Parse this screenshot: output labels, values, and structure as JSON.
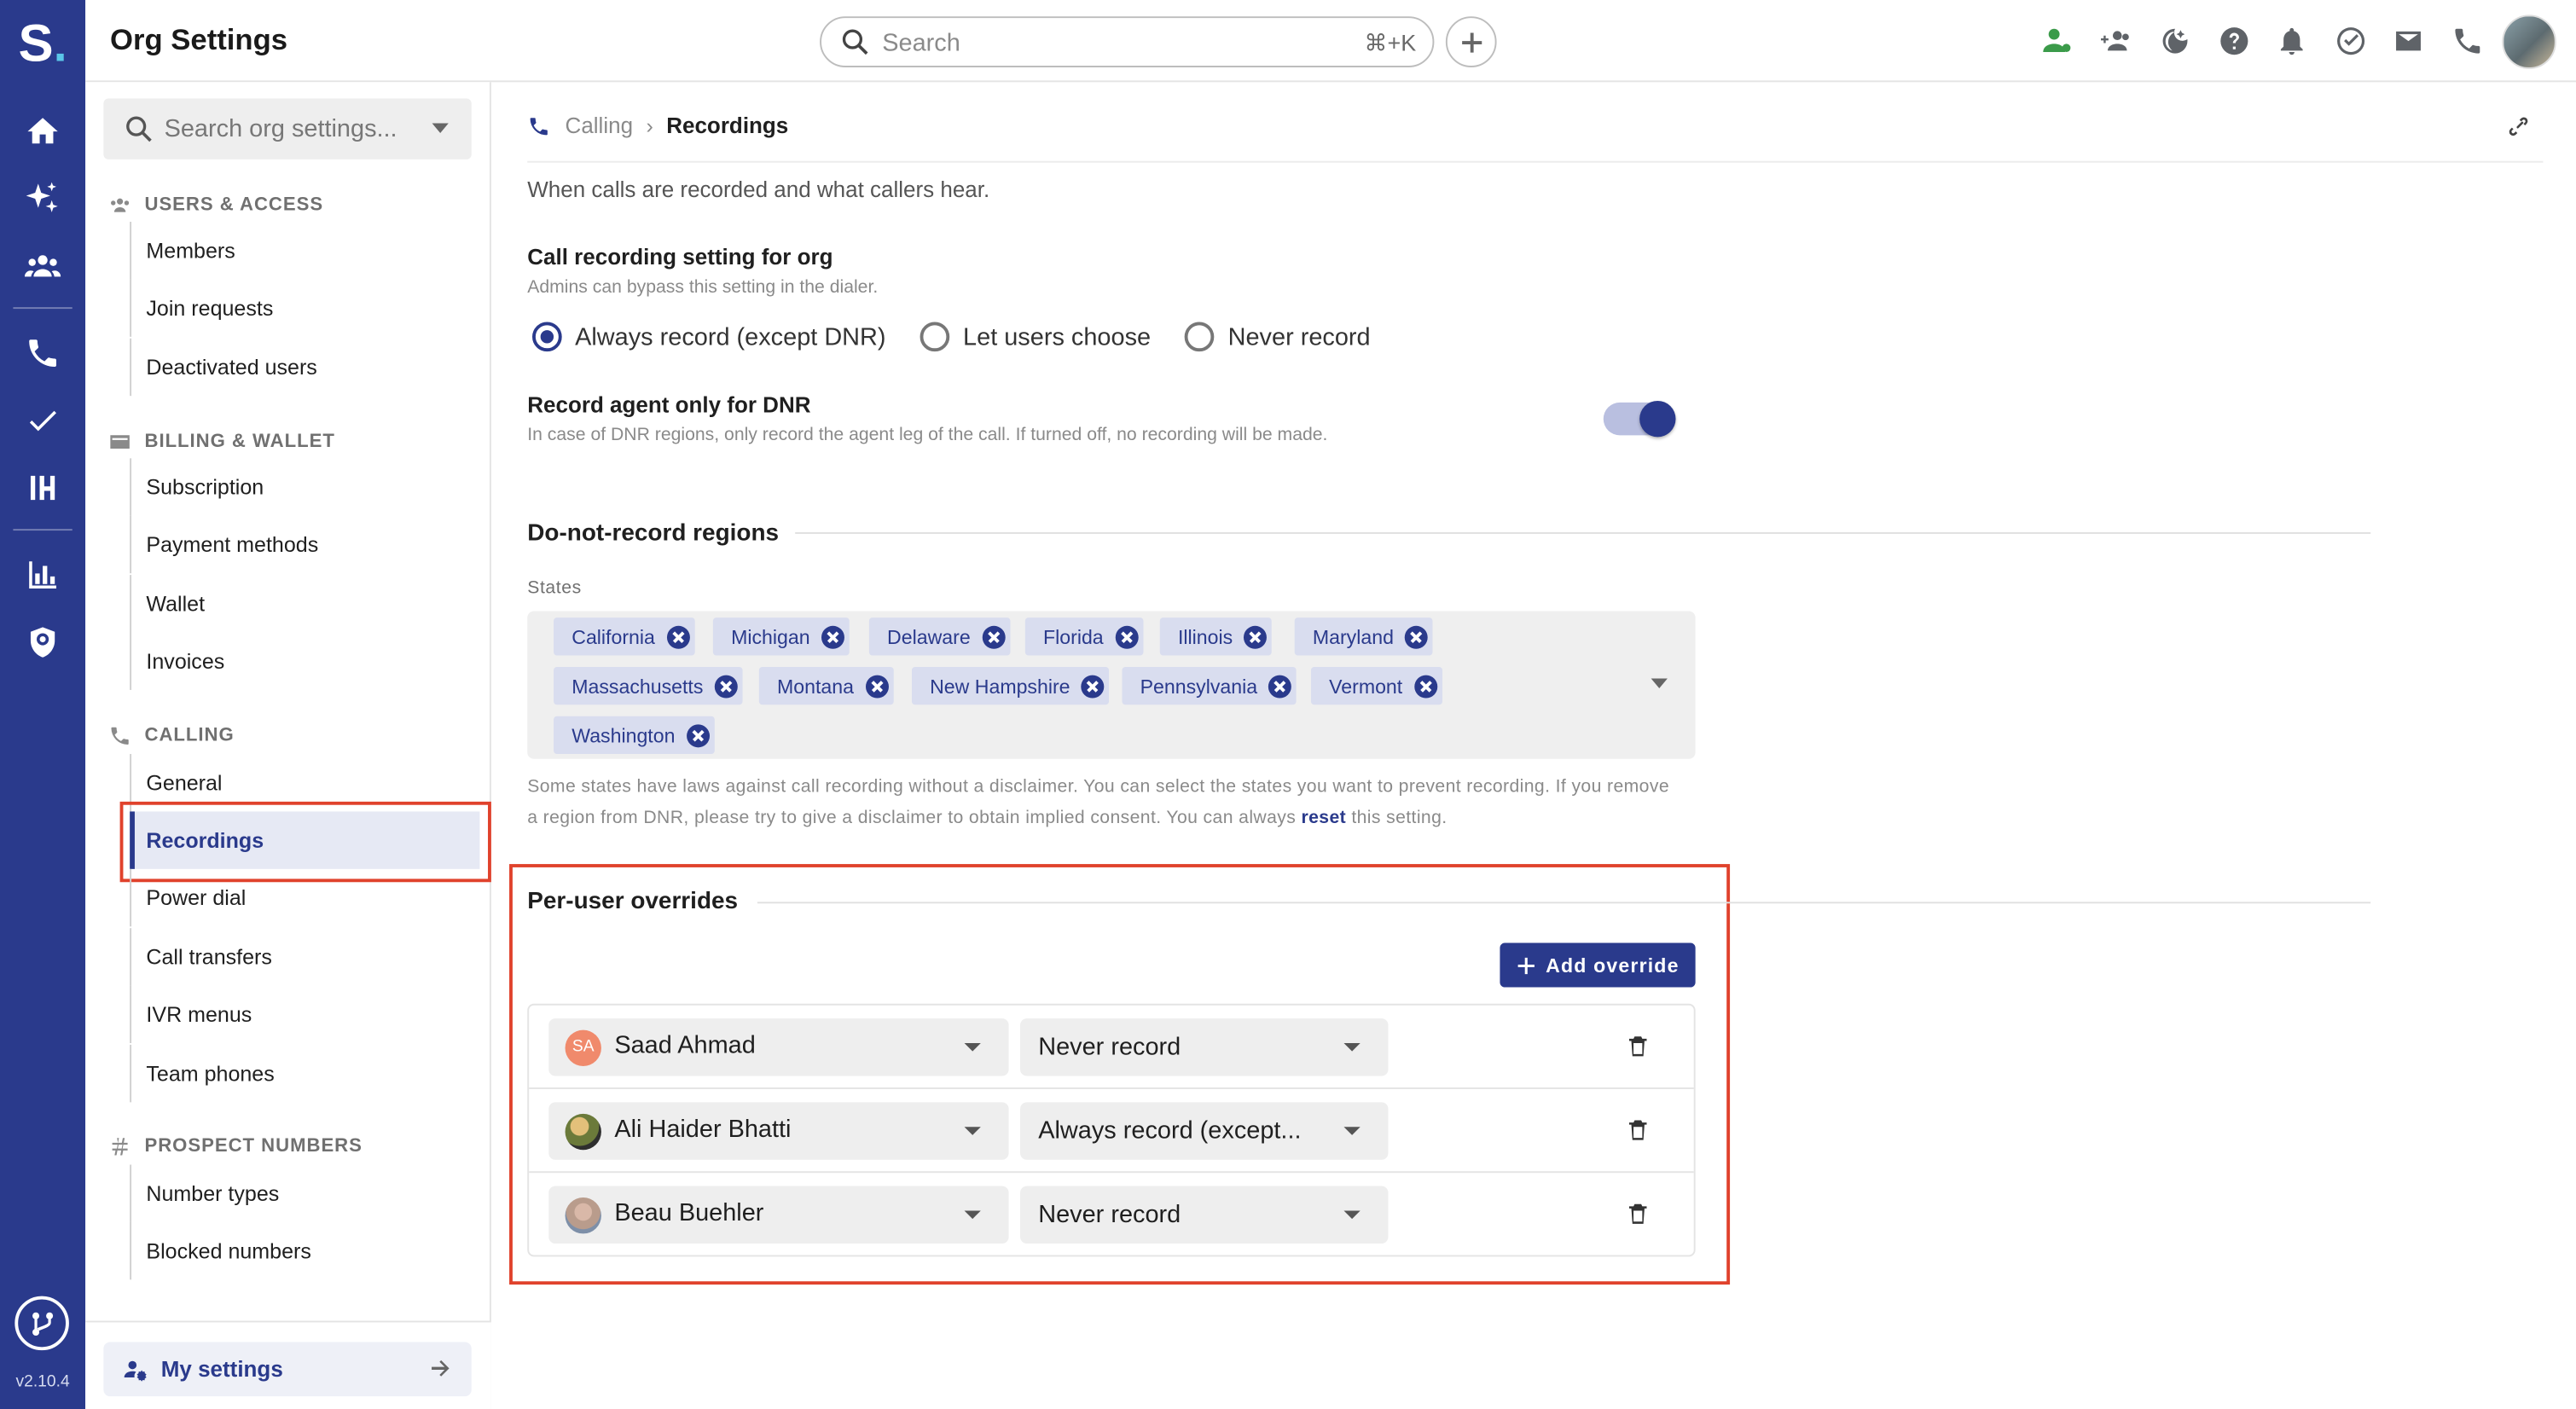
{
  "app": {
    "logo": "S",
    "version": "v2.10.4",
    "title": "Org Settings"
  },
  "rail": {
    "icons": [
      "home-icon",
      "sparkle-icon",
      "team-icon",
      "phone-icon",
      "check-icon",
      "hub-icon",
      "bar-chart-icon",
      "shield-icon",
      "integrations-icon"
    ]
  },
  "topbar": {
    "search_placeholder": "Search",
    "search_shortcut": "⌘+K",
    "icons": [
      "user-status-icon",
      "add-user-icon",
      "do-not-disturb-icon",
      "help-icon",
      "notifications-icon",
      "tasks-icon",
      "mail-icon",
      "phone-icon",
      "avatar"
    ]
  },
  "sidebar": {
    "search_placeholder": "Search org settings...",
    "sections": [
      {
        "title": "USERS & ACCESS",
        "items": [
          "Members",
          "Join requests",
          "Deactivated users"
        ]
      },
      {
        "title": "BILLING & WALLET",
        "items": [
          "Subscription",
          "Payment methods",
          "Wallet",
          "Invoices"
        ]
      },
      {
        "title": "CALLING",
        "items": [
          "General",
          "Recordings",
          "Power dial",
          "Call transfers",
          "IVR menus",
          "Team phones"
        ]
      },
      {
        "title": "PROSPECT NUMBERS",
        "items": [
          "Number types",
          "Blocked numbers"
        ]
      }
    ],
    "active_item": "Recordings",
    "footer_label": "My settings"
  },
  "main": {
    "breadcrumb": {
      "parent": "Calling",
      "current": "Recordings"
    },
    "description": "When calls are recorded and what callers hear.",
    "recording_setting": {
      "title": "Call recording setting for org",
      "subtitle": "Admins can bypass this setting in the dialer.",
      "options": [
        "Always record (except DNR)",
        "Let users choose",
        "Never record"
      ],
      "selected": "Always record (except DNR)"
    },
    "agent_only": {
      "title": "Record agent only for DNR",
      "subtitle": "In case of DNR regions, only record the agent leg of the call. If turned off, no recording will be made.",
      "enabled": true
    },
    "dnr": {
      "title": "Do-not-record regions",
      "states_label": "States",
      "states": [
        "California",
        "Michigan",
        "Delaware",
        "Florida",
        "Illinois",
        "Maryland",
        "Massachusetts",
        "Montana",
        "New Hampshire",
        "Pennsylvania",
        "Vermont",
        "Washington"
      ],
      "help_before": "Some states have laws against call recording without a disclaimer. You can select the states you want to prevent recording. If you remove a region from DNR, please try to give a disclaimer to obtain implied consent. You can always ",
      "help_link": "reset",
      "help_after": " this setting."
    },
    "overrides": {
      "title": "Per-user overrides",
      "add_label": "Add override",
      "rows": [
        {
          "user": "Saad Ahmad",
          "initials": "SA",
          "avatar_color": "#f08a6c",
          "mode": "Never record"
        },
        {
          "user": "Ali Haider Bhatti",
          "initials": "",
          "avatar_color": "#6b7a3a",
          "mode": "Always record (except..."
        },
        {
          "user": "Beau Buehler",
          "initials": "",
          "avatar_color": "#b99c8c",
          "mode": "Never record"
        }
      ]
    }
  },
  "colors": {
    "brand": "#2a3a8c",
    "highlight": "#e0422c",
    "chip_bg": "#d9ddef"
  }
}
